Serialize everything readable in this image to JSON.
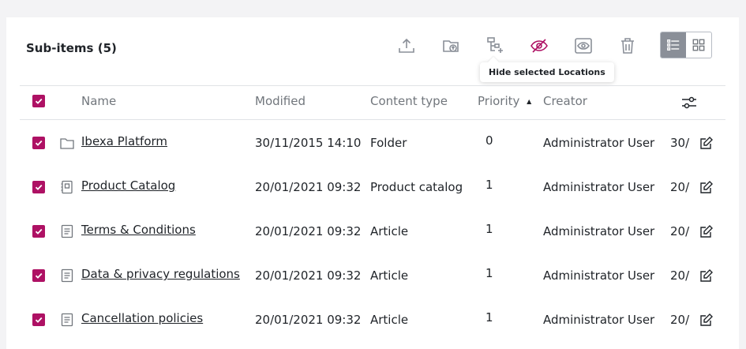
{
  "header": {
    "title": "Sub-items (5)",
    "tooltip": "Hide selected Locations"
  },
  "columns": {
    "name": "Name",
    "modified": "Modified",
    "content_type": "Content type",
    "priority": "Priority",
    "creator": "Creator"
  },
  "rows": [
    {
      "name": "Ibexa Platform",
      "modified": "30/11/2015 14:10",
      "content_type": "Folder",
      "priority": "0",
      "creator": "Administrator User",
      "extra": "30/",
      "icon": "folder-icon"
    },
    {
      "name": "Product Catalog",
      "modified": "20/01/2021 09:32",
      "content_type": "Product catalog",
      "priority": "1",
      "creator": "Administrator User",
      "extra": "20/",
      "icon": "catalog-icon"
    },
    {
      "name": "Terms & Conditions",
      "modified": "20/01/2021 09:32",
      "content_type": "Article",
      "priority": "1",
      "creator": "Administrator User",
      "extra": "20/",
      "icon": "article-icon"
    },
    {
      "name": "Data & privacy regulations",
      "modified": "20/01/2021 09:32",
      "content_type": "Article",
      "priority": "1",
      "creator": "Administrator User",
      "extra": "20/",
      "icon": "article-icon"
    },
    {
      "name": "Cancellation policies",
      "modified": "20/01/2021 09:32",
      "content_type": "Article",
      "priority": "1",
      "creator": "Administrator User",
      "extra": "20/",
      "icon": "article-icon"
    }
  ],
  "colors": {
    "accent": "#ae1164",
    "muted": "#71767c",
    "border": "#e0e2e6"
  }
}
